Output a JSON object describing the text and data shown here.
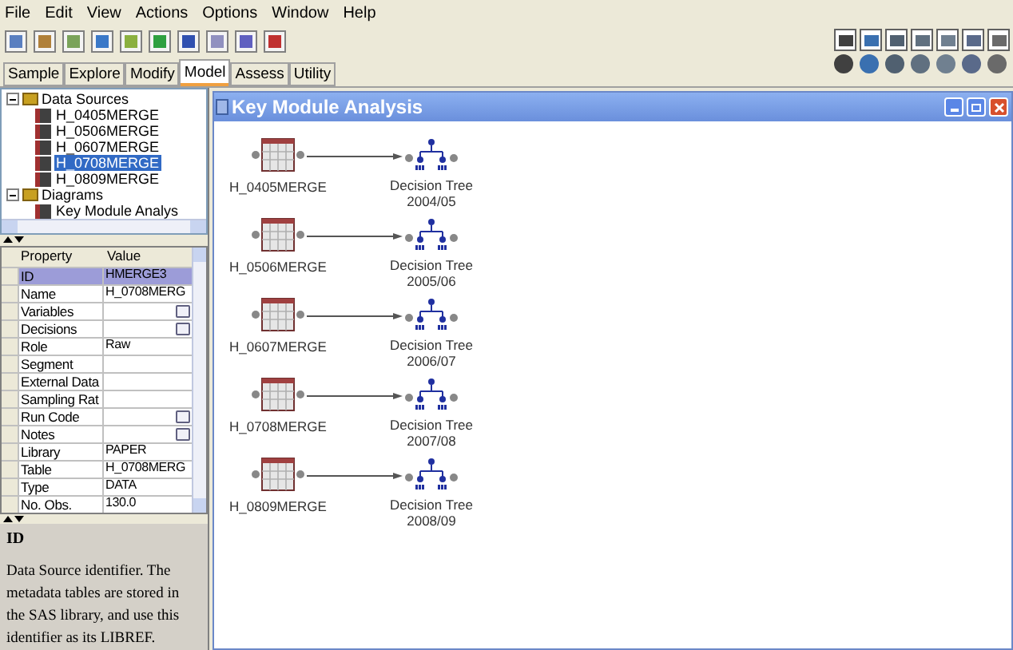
{
  "menu": [
    "File",
    "Edit",
    "View",
    "Actions",
    "Options",
    "Window",
    "Help"
  ],
  "tabs": [
    {
      "label": "Sample",
      "selected": false
    },
    {
      "label": "Explore",
      "selected": false
    },
    {
      "label": "Modify",
      "selected": false
    },
    {
      "label": "Model",
      "selected": true
    },
    {
      "label": "Assess",
      "selected": false
    },
    {
      "label": "Utility",
      "selected": false
    }
  ],
  "tree": [
    {
      "label": "Data Sources",
      "expanded": true,
      "children": [
        {
          "label": "H_0405MERGE",
          "selected": false
        },
        {
          "label": "H_0506MERGE",
          "selected": false
        },
        {
          "label": "H_0607MERGE",
          "selected": false
        },
        {
          "label": "H_0708MERGE",
          "selected": true
        },
        {
          "label": "H_0809MERGE",
          "selected": false
        }
      ]
    },
    {
      "label": "Diagrams",
      "expanded": true,
      "children": [
        {
          "label": "Key Module Analys",
          "selected": false
        }
      ]
    }
  ],
  "properties": {
    "columns": [
      "Property",
      "Value"
    ],
    "rows": [
      {
        "name": "ID",
        "value": "HMERGE3",
        "kind": "text",
        "selected": true
      },
      {
        "name": "Name",
        "value": "H_0708MERG",
        "kind": "text",
        "selected": false
      },
      {
        "name": "Variables",
        "kind": "button",
        "selected": false
      },
      {
        "name": "Decisions",
        "kind": "button",
        "selected": false
      },
      {
        "name": "Role",
        "value": "Raw",
        "kind": "text",
        "selected": false
      },
      {
        "name": "Segment",
        "kind": "text",
        "selected": false
      },
      {
        "name": "External Data",
        "kind": "text",
        "selected": false
      },
      {
        "name": "Sampling Rat",
        "kind": "text",
        "selected": false
      },
      {
        "name": "Run Code",
        "kind": "button",
        "selected": false
      },
      {
        "name": "Notes",
        "kind": "button",
        "selected": false
      },
      {
        "name": "Library",
        "value": "PAPER",
        "kind": "text",
        "selected": false
      },
      {
        "name": "Table",
        "value": "H_0708MERG",
        "kind": "text",
        "selected": false
      },
      {
        "name": "Type",
        "value": "DATA",
        "kind": "text",
        "selected": false
      },
      {
        "name": "No. Obs.",
        "value": "130.0",
        "kind": "text",
        "selected": false
      }
    ]
  },
  "description": {
    "title": "ID",
    "text": "Data Source identifier. The metadata tables are stored in the SAS library, and use this identifier as its LIBREF."
  },
  "window": {
    "title": "Key Module Analysis"
  },
  "flows": [
    {
      "source": "H_0405MERGE",
      "target": "Decision Tree",
      "target_period": "2004/05"
    },
    {
      "source": "H_0506MERGE",
      "target": "Decision Tree",
      "target_period": "2005/06"
    },
    {
      "source": "H_0607MERGE",
      "target": "Decision Tree",
      "target_period": "2006/07"
    },
    {
      "source": "H_0708MERGE",
      "target": "Decision Tree",
      "target_period": "2007/08"
    },
    {
      "source": "H_0809MERGE",
      "target": "Decision Tree",
      "target_period": "2008/09"
    }
  ]
}
